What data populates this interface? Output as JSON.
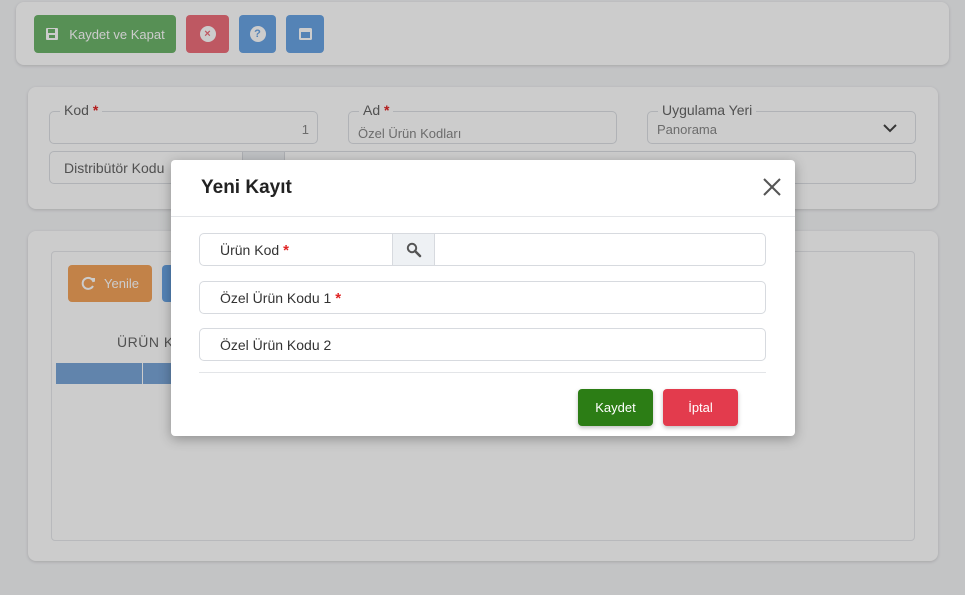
{
  "toolbar": {
    "save_close_label": "Kaydet ve Kapat",
    "close_icon": "close-circle-icon",
    "help_icon": "question-circle-icon",
    "window_icon": "window-icon"
  },
  "form": {
    "kod": {
      "label": "Kod",
      "value": "1",
      "required": "*"
    },
    "ad": {
      "label": "Ad",
      "value": "Özel Ürün Kodları",
      "required": "*"
    },
    "uygulama_yeri": {
      "label": "Uygulama Yeri",
      "value": "Panorama"
    },
    "distributor_kodu": {
      "label": "Distribütör Kodu"
    }
  },
  "grid": {
    "refresh_label": "Yenile",
    "column_header": "ÜRÜN KO"
  },
  "modal": {
    "title": "Yeni Kayıt",
    "fields": [
      {
        "label": "Ürün Kod",
        "required": "*"
      },
      {
        "label": "Özel Ürün Kodu 1",
        "required": "*"
      },
      {
        "label": "Özel Ürün Kodu 2"
      }
    ],
    "save_label": "Kaydet",
    "cancel_label": "İptal"
  },
  "colors": {
    "save_green": "#2c7d15",
    "cancel_red": "#e33b4d",
    "required_red": "#e02424",
    "toolbar_green": "#6db56b",
    "toolbar_blue": "#6aa4e4",
    "refresh_orange": "#f3a35b"
  }
}
